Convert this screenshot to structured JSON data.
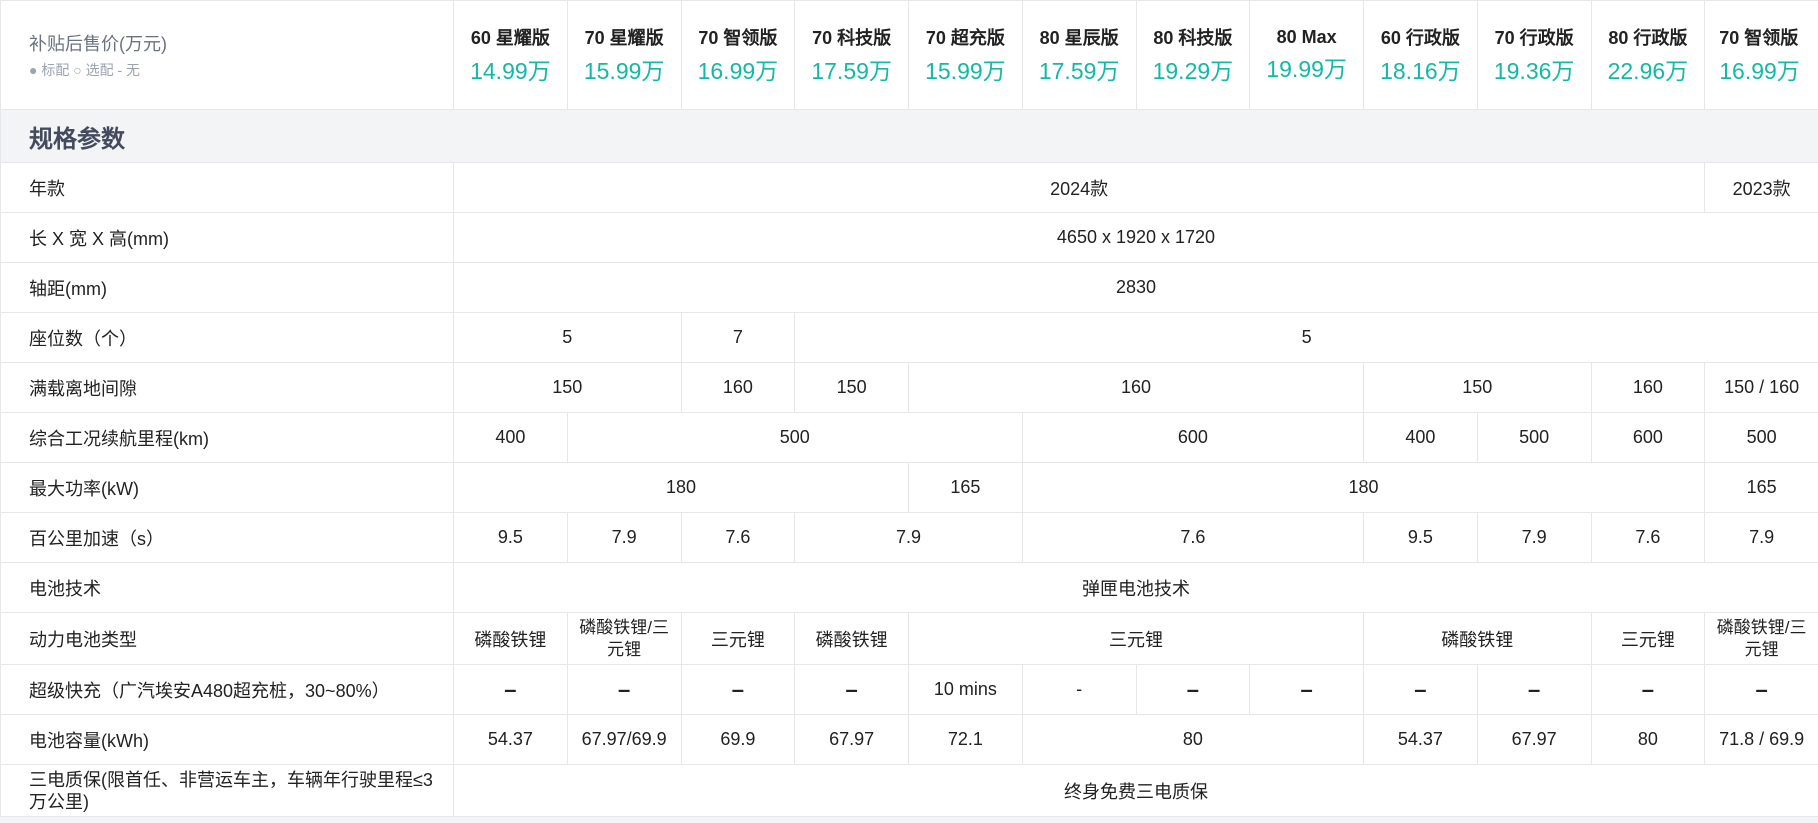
{
  "header": {
    "label_main": "补贴后售价(万元)",
    "label_sub": "● 标配 ○ 选配 - 无",
    "trims": [
      {
        "name": "60 星耀版",
        "price": "14.99万"
      },
      {
        "name": "70 星耀版",
        "price": "15.99万"
      },
      {
        "name": "70 智领版",
        "price": "16.99万"
      },
      {
        "name": "70 科技版",
        "price": "17.59万"
      },
      {
        "name": "70 超充版",
        "price": "15.99万"
      },
      {
        "name": "80 星辰版",
        "price": "17.59万"
      },
      {
        "name": "80 科技版",
        "price": "19.29万"
      },
      {
        "name": "80 Max",
        "price": "19.99万"
      },
      {
        "name": "60 行政版",
        "price": "18.16万"
      },
      {
        "name": "70 行政版",
        "price": "19.36万"
      },
      {
        "name": "80 行政版",
        "price": "22.96万"
      },
      {
        "name": "70 智领版",
        "price": "16.99万"
      }
    ]
  },
  "section_title": "规格参数",
  "rows": {
    "year": {
      "label": "年款",
      "v1": "2024款",
      "v2": "2023款"
    },
    "dimensions": {
      "label": "长 X 宽 X 高(mm)",
      "v1": "4650 x 1920 x 1720"
    },
    "wheelbase": {
      "label": "轴距(mm)",
      "v1": "2830"
    },
    "seats": {
      "label": "座位数（个）",
      "v1": "5",
      "v2": "7",
      "v3": "5"
    },
    "clearance": {
      "label": "满载离地间隙",
      "v1": "150",
      "v2": "160",
      "v3": "150",
      "v4": "160",
      "v5": "150",
      "v6": "160",
      "v7": "150 / 160"
    },
    "range": {
      "label": "综合工况续航里程(km)",
      "v1": "400",
      "v2": "500",
      "v3": "600",
      "v4": "400",
      "v5": "500",
      "v6": "600",
      "v7": "500"
    },
    "power": {
      "label": "最大功率(kW)",
      "v1": "180",
      "v2": "165",
      "v3": "180",
      "v4": "165"
    },
    "accel": {
      "label": "百公里加速（s）",
      "v1": "9.5",
      "v2": "7.9",
      "v3": "7.6",
      "v4": "7.9",
      "v5": "7.6",
      "v6": "9.5",
      "v7": "7.9",
      "v8": "7.6",
      "v9": "7.9"
    },
    "battery_tech": {
      "label": "电池技术",
      "v1": "弹匣电池技术"
    },
    "battery_type": {
      "label": "动力电池类型",
      "v1": "磷酸铁锂",
      "v2": "磷酸铁锂/三元锂",
      "v3": "三元锂",
      "v4": "磷酸铁锂",
      "v5": "三元锂",
      "v6": "磷酸铁锂",
      "v7": "三元锂",
      "v8": "磷酸铁锂/三元锂"
    },
    "fast_charge": {
      "label": "超级快充（广汽埃安A480超充桩，30~80%）",
      "dash": "–",
      "v5": "10 mins",
      "v6": "-"
    },
    "capacity": {
      "label": "电池容量(kWh)",
      "v1": "54.37",
      "v2": "67.97/69.9",
      "v3": "69.9",
      "v4": "67.97",
      "v5": "72.1",
      "v6": "80",
      "v7": "54.37",
      "v8": "67.97",
      "v9": "80",
      "v10": "71.8 / 69.9"
    },
    "warranty": {
      "label": "三电质保(限首任、非营运车主，车辆年行驶里程≤3万公里)",
      "v1": "终身免费三电质保"
    }
  }
}
